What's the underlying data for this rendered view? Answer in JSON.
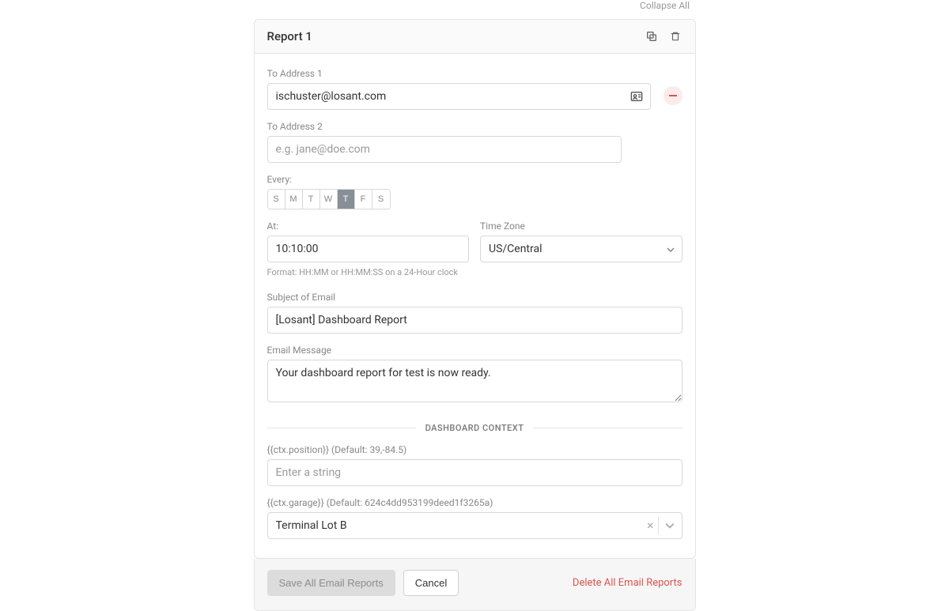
{
  "topbar": {
    "collapse_all": "Collapse All"
  },
  "report": {
    "title": "Report 1",
    "to_address_1": {
      "label": "To Address 1",
      "value": "ischuster@losant.com"
    },
    "to_address_2": {
      "label": "To Address 2",
      "placeholder": "e.g. jane@doe.com"
    },
    "every": {
      "label": "Every:",
      "days": [
        "S",
        "M",
        "T",
        "W",
        "T",
        "F",
        "S"
      ],
      "active_index": 4
    },
    "at": {
      "label": "At:",
      "value": "10:10:00",
      "hint": "Format: HH:MM or HH:MM:SS on a 24-Hour clock"
    },
    "timezone": {
      "label": "Time Zone",
      "value": "US/Central"
    },
    "subject": {
      "label": "Subject of Email",
      "value": "[Losant] Dashboard Report"
    },
    "message": {
      "label": "Email Message",
      "value": "Your dashboard report for test is now ready."
    },
    "context": {
      "heading": "DASHBOARD CONTEXT",
      "position": {
        "label": "{{ctx.position}} (Default: 39,-84.5)",
        "placeholder": "Enter a string"
      },
      "garage": {
        "label": "{{ctx.garage}} (Default: 624c4dd953199deed1f3265a)",
        "value": "Terminal Lot B"
      }
    }
  },
  "footer": {
    "save": "Save All Email Reports",
    "cancel": "Cancel",
    "delete": "Delete All Email Reports"
  }
}
